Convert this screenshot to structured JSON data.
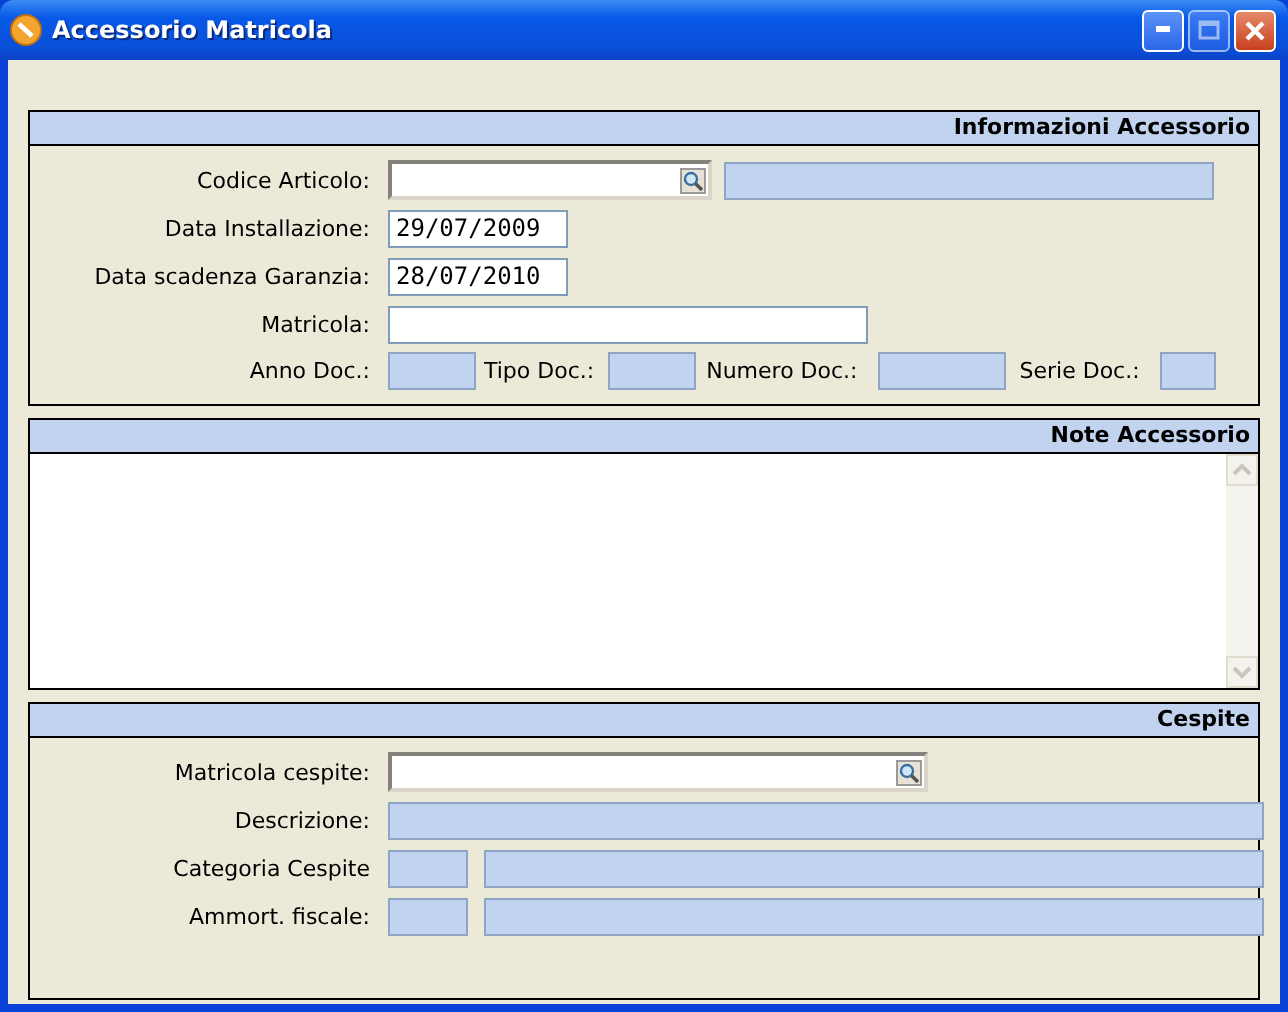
{
  "window": {
    "title": "Accessorio Matricola"
  },
  "sections": [
    {
      "title": "Informazioni Accessorio",
      "kind": "form",
      "rows": [
        {
          "cells": [
            {
              "kind": "label",
              "text": "Codice Articolo:"
            },
            {
              "kind": "lookup"
            },
            {
              "kind": "readonly"
            }
          ]
        },
        {
          "cells": [
            {
              "kind": "label",
              "text": "Data Installazione:"
            },
            {
              "kind": "date",
              "value": "29/07/2009"
            }
          ]
        },
        {
          "cells": [
            {
              "kind": "label",
              "text": "Data scadenza Garanzia:"
            },
            {
              "kind": "date",
              "value": "28/07/2010"
            }
          ]
        },
        {
          "cells": [
            {
              "kind": "label",
              "text": "Matricola:"
            },
            {
              "kind": "text"
            }
          ]
        },
        {
          "cells": [
            {
              "kind": "label",
              "text": "Anno Doc.:"
            },
            {
              "kind": "readonly"
            },
            {
              "kind": "label",
              "text": "Tipo Doc.:"
            },
            {
              "kind": "readonly"
            },
            {
              "kind": "label",
              "text": "Numero Doc.:"
            },
            {
              "kind": "readonly"
            },
            {
              "kind": "label",
              "text": "Serie Doc.:"
            },
            {
              "kind": "readonly"
            }
          ]
        }
      ]
    },
    {
      "title": "Note Accessorio",
      "kind": "notes"
    },
    {
      "title": "Cespite",
      "kind": "form",
      "rows": [
        {
          "cells": [
            {
              "kind": "label",
              "text": "Matricola cespite:"
            },
            {
              "kind": "lookup"
            }
          ]
        },
        {
          "cells": [
            {
              "kind": "label",
              "text": "Descrizione:"
            },
            {
              "kind": "readonly"
            }
          ]
        },
        {
          "cells": [
            {
              "kind": "label",
              "text": "Categoria Cespite"
            },
            {
              "kind": "readonly"
            },
            {
              "kind": "readonly"
            }
          ]
        },
        {
          "cells": [
            {
              "kind": "label",
              "text": "Ammort. fiscale:"
            },
            {
              "kind": "readonly"
            },
            {
              "kind": "readonly"
            }
          ]
        }
      ]
    }
  ]
}
